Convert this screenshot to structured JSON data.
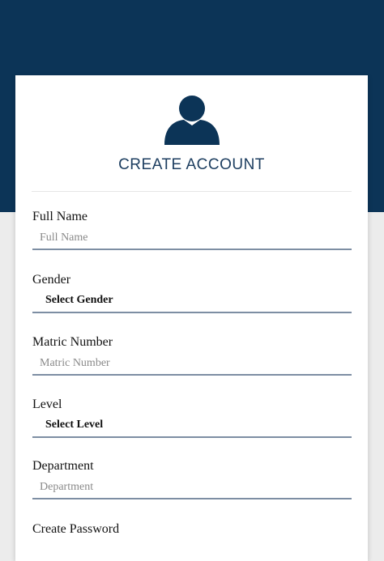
{
  "colors": {
    "header_band": "#0c3457",
    "accent": "#1d3e60",
    "input_underline": "#7d8ea3"
  },
  "header": {
    "avatar_icon": "user-icon",
    "title": "CREATE ACCOUNT"
  },
  "form": {
    "full_name": {
      "label": "Full Name",
      "placeholder": "Full Name",
      "value": ""
    },
    "gender": {
      "label": "Gender",
      "selected": "Select Gender"
    },
    "matric_number": {
      "label": "Matric Number",
      "placeholder": "Matric Number",
      "value": ""
    },
    "level": {
      "label": "Level",
      "selected": "Select Level"
    },
    "department": {
      "label": "Department",
      "placeholder": "Department",
      "value": ""
    },
    "create_password": {
      "label": "Create Password"
    }
  }
}
